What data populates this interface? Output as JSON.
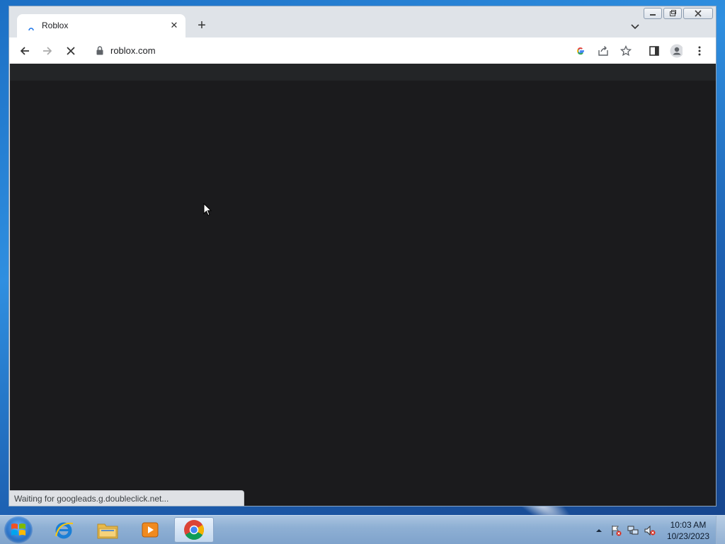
{
  "browser": {
    "tab": {
      "title": "Roblox",
      "close_label": "✕"
    },
    "new_tab_label": "+",
    "toolbar": {
      "url": "roblox.com"
    },
    "status_text": "Waiting for googleads.g.doubleclick.net..."
  },
  "taskbar": {
    "apps": [
      "internet-explorer",
      "windows-explorer",
      "media-player",
      "chrome"
    ],
    "clock": {
      "time": "10:03 AM",
      "date": "10/23/2023"
    }
  },
  "colors": {
    "content_bg": "#1b1b1d",
    "content_topbar": "#232527",
    "accent_blue": "#1a73e8"
  }
}
